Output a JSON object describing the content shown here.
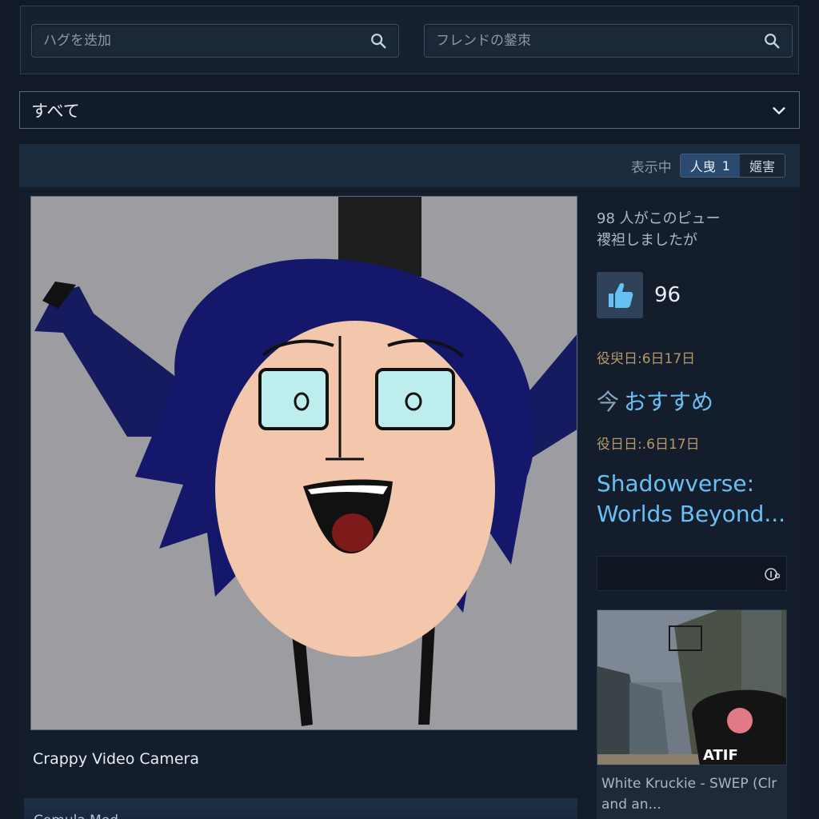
{
  "search": {
    "hug_placeholder": "ハグを迭加",
    "friend_placeholder": "フレンドの錖朿"
  },
  "filter": {
    "selected": "すべて"
  },
  "header": {
    "showing_label": "表示中",
    "toggle_people": "人曳",
    "toggle_number": "1",
    "toggle_other": "嫟害"
  },
  "review": {
    "helpful_line1": "98 人がこのピュー",
    "helpful_line2": "禝袒しましたが",
    "thumbs_count": "96",
    "posted_date": "役臾日:6日17日",
    "recommend_label": "おすすめ",
    "updated_date": "役日日:.6日17日",
    "game_title": "Shadowverse: Worlds Beyond..."
  },
  "screenshot": {
    "caption": "Crappy Video Camera"
  },
  "below": {
    "text": "Comula Mod..."
  },
  "card": {
    "text_line1": "White Kruckie - SWEP (Clr",
    "text_line2": "and an...",
    "sign": "ATIF"
  },
  "colors": {
    "accent_blue": "#66c0f4",
    "date_gold": "#b69869",
    "bg": "#121a28"
  }
}
